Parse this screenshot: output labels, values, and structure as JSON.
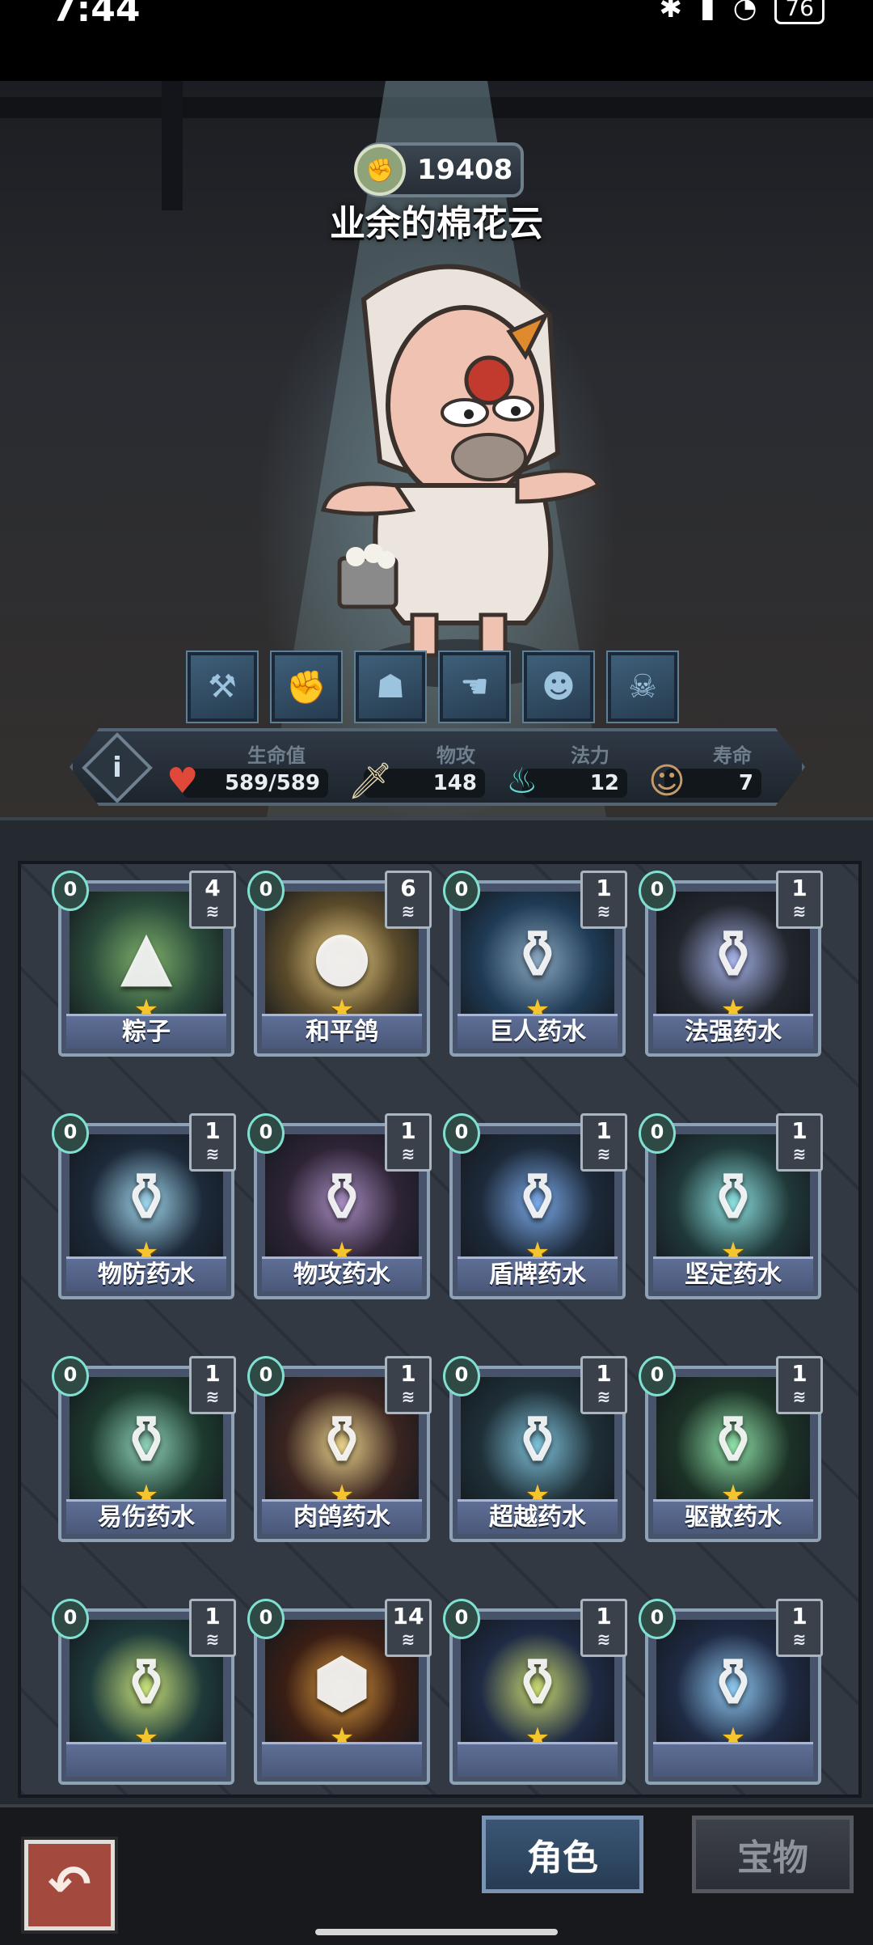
{
  "status_bar": {
    "time": "7:44",
    "battery": "76"
  },
  "hero": {
    "score": "19408",
    "name": "业余的棉花云",
    "skills": [
      "skill-1",
      "skill-2",
      "skill-3",
      "skill-4",
      "skill-5",
      "skill-6"
    ]
  },
  "stats": {
    "hp": {
      "label": "生命值",
      "value": "589/589"
    },
    "attack": {
      "label": "物攻",
      "value": "148"
    },
    "magic": {
      "label": "法力",
      "value": "12"
    },
    "lifespan": {
      "label": "寿命",
      "value": "7"
    }
  },
  "items": [
    {
      "name": "粽子",
      "cost": "0",
      "count": "4",
      "icon": "zongzi-icon",
      "c1": "#2a4a3a",
      "c2": "#7fb06a",
      "glyph": "▲"
    },
    {
      "name": "和平鸽",
      "cost": "0",
      "count": "6",
      "icon": "dove-silhouette-icon",
      "c1": "#5a4a2a",
      "c2": "#f1d48a",
      "glyph": "●"
    },
    {
      "name": "巨人药水",
      "cost": "0",
      "count": "1",
      "icon": "potion-icon",
      "c1": "#1f3b55",
      "c2": "#8aa7c0",
      "glyph": "⚱"
    },
    {
      "name": "法强药水",
      "cost": "0",
      "count": "1",
      "icon": "potion-icon",
      "c1": "#22262d",
      "c2": "#a7b4ea",
      "glyph": "⚱"
    },
    {
      "name": "物防药水",
      "cost": "0",
      "count": "1",
      "icon": "potion-icon",
      "c1": "#1d2a3a",
      "c2": "#9fd4ea",
      "glyph": "⚱"
    },
    {
      "name": "物攻药水",
      "cost": "0",
      "count": "1",
      "icon": "potion-icon",
      "c1": "#2e2436",
      "c2": "#a68cc0",
      "glyph": "⚱"
    },
    {
      "name": "盾牌药水",
      "cost": "0",
      "count": "1",
      "icon": "potion-icon",
      "c1": "#1d2a3a",
      "c2": "#7aa9e8",
      "glyph": "⚱"
    },
    {
      "name": "坚定药水",
      "cost": "0",
      "count": "1",
      "icon": "potion-icon",
      "c1": "#203838",
      "c2": "#8de0e0",
      "glyph": "⚱"
    },
    {
      "name": "易伤药水",
      "cost": "0",
      "count": "1",
      "icon": "potion-icon",
      "c1": "#1d3a2e",
      "c2": "#8ed0b8",
      "glyph": "⚱"
    },
    {
      "name": "肉鸽药水",
      "cost": "0",
      "count": "1",
      "icon": "potion-icon",
      "c1": "#3a2420",
      "c2": "#e7d08a",
      "glyph": "⚱"
    },
    {
      "name": "超越药水",
      "cost": "0",
      "count": "1",
      "icon": "potion-icon",
      "c1": "#1f3038",
      "c2": "#7ec0d8",
      "glyph": "⚱"
    },
    {
      "name": "驱散药水",
      "cost": "0",
      "count": "1",
      "icon": "potion-icon",
      "c1": "#1c3226",
      "c2": "#8fe0a8",
      "glyph": "⚱"
    },
    {
      "name": "",
      "cost": "0",
      "count": "1",
      "icon": "potion-icon",
      "c1": "#1e3a3a",
      "c2": "#c8e07a",
      "glyph": "⚱"
    },
    {
      "name": "",
      "cost": "0",
      "count": "14",
      "icon": "honeycomb-icon",
      "c1": "#3a1e14",
      "c2": "#e3a040",
      "glyph": "⬢"
    },
    {
      "name": "",
      "cost": "0",
      "count": "1",
      "icon": "potion-icon",
      "c1": "#1f2a44",
      "c2": "#c8d870",
      "glyph": "⚱"
    },
    {
      "name": "",
      "cost": "0",
      "count": "1",
      "icon": "potion-icon",
      "c1": "#1f2a44",
      "c2": "#8ec8f0",
      "glyph": "⚱"
    }
  ],
  "nav": {
    "back_glyph": "↶",
    "role_label": "角色",
    "treasure_label": "宝物"
  }
}
